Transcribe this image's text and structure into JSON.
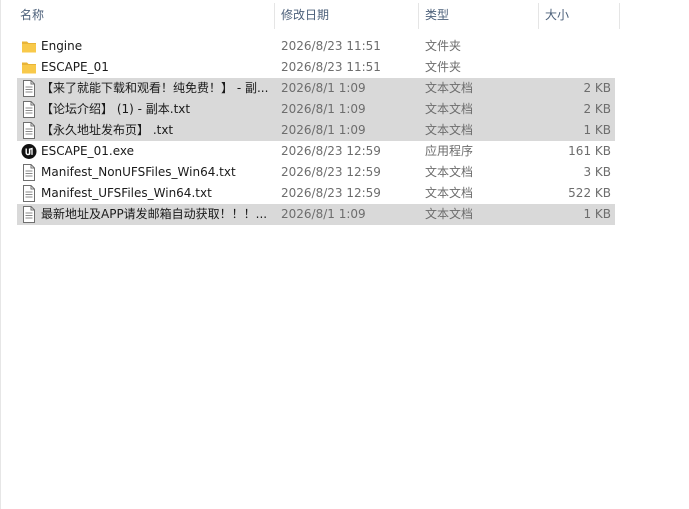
{
  "columns": {
    "name": "名称",
    "date": "修改日期",
    "type": "类型",
    "size": "大小",
    "sort_indicator": "^"
  },
  "files": [
    {
      "name": "Engine",
      "date": "2026/8/23 11:51",
      "type": "文件夹",
      "size": "",
      "icon": "folder-icon",
      "selected": false
    },
    {
      "name": "ESCAPE_01",
      "date": "2026/8/23 11:51",
      "type": "文件夹",
      "size": "",
      "icon": "folder-icon",
      "selected": false
    },
    {
      "name": "【来了就能下载和观看！纯免费！】 - 副...",
      "date": "2026/8/1 1:09",
      "type": "文本文档",
      "size": "2 KB",
      "icon": "text-file-icon",
      "selected": true
    },
    {
      "name": "【论坛介绍】 (1) - 副本.txt",
      "date": "2026/8/1 1:09",
      "type": "文本文档",
      "size": "2 KB",
      "icon": "text-file-icon",
      "selected": true
    },
    {
      "name": "【永久地址发布页】 .txt",
      "date": "2026/8/1 1:09",
      "type": "文本文档",
      "size": "1 KB",
      "icon": "text-file-icon",
      "selected": true
    },
    {
      "name": "ESCAPE_01.exe",
      "date": "2026/8/23 12:59",
      "type": "应用程序",
      "size": "161 KB",
      "icon": "unreal-engine-icon",
      "selected": false
    },
    {
      "name": "Manifest_NonUFSFiles_Win64.txt",
      "date": "2026/8/23 12:59",
      "type": "文本文档",
      "size": "3 KB",
      "icon": "text-file-icon",
      "selected": false
    },
    {
      "name": "Manifest_UFSFiles_Win64.txt",
      "date": "2026/8/23 12:59",
      "type": "文本文档",
      "size": "522 KB",
      "icon": "text-file-icon",
      "selected": false
    },
    {
      "name": "最新地址及APP请发邮箱自动获取！！！...",
      "date": "2026/8/1 1:09",
      "type": "文本文档",
      "size": "1 KB",
      "icon": "text-file-icon",
      "selected": true
    }
  ],
  "colors": {
    "header_text": "#4c607a",
    "selection": "#d9d9d9",
    "folder": "#f8c94a"
  }
}
